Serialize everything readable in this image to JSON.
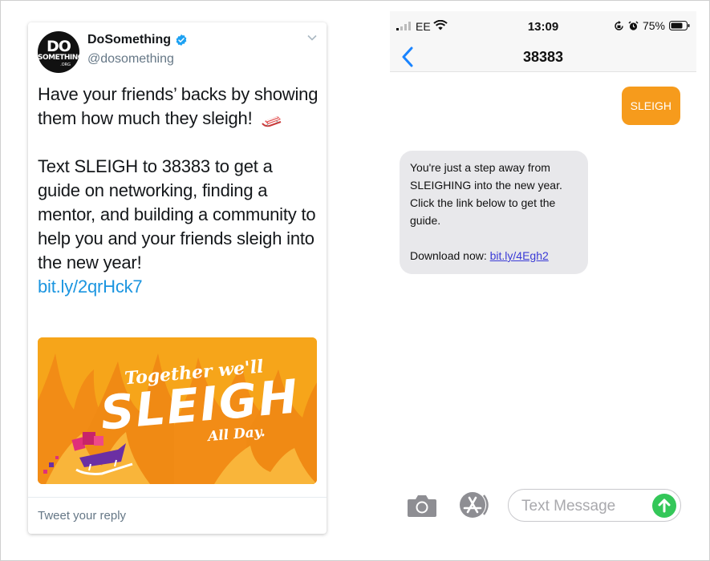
{
  "tweet": {
    "avatar_text": "DO",
    "avatar_sub": "SOMETHING",
    "avatar_org": ".ORG",
    "display_name": "DoSomething",
    "handle": "@dosomething",
    "paragraph1": "Have your friends’ backs by showing them how much they sleigh!",
    "paragraph2": "Text SLEIGH to 38383 to get a guide on networking, finding a mentor, and building a community to help you and your friends sleigh into the new year!",
    "link": "bit.ly/2qrHck7",
    "media": {
      "line1": "Together we'll",
      "line2": "SLEIGH",
      "line3": "All Day.",
      "bg_color": "#f6a51a"
    },
    "reply_placeholder": "Tweet your reply",
    "verified_color": "#1da1f2",
    "link_color": "#1b95e0"
  },
  "phone": {
    "status": {
      "carrier": "EE",
      "time": "13:09",
      "battery": "75%"
    },
    "contact": "38383",
    "outgoing": "SLEIGH",
    "incoming_lines": [
      "You're just a step away from SLEIGHING into the new year. Click the link below to get the guide.",
      "Download now: "
    ],
    "incoming_link": "bit.ly/4Egh2",
    "input_placeholder": "Text Message",
    "accent_outgoing": "#f69b1c",
    "send_color": "#34c759",
    "back_color": "#1a84ff"
  }
}
